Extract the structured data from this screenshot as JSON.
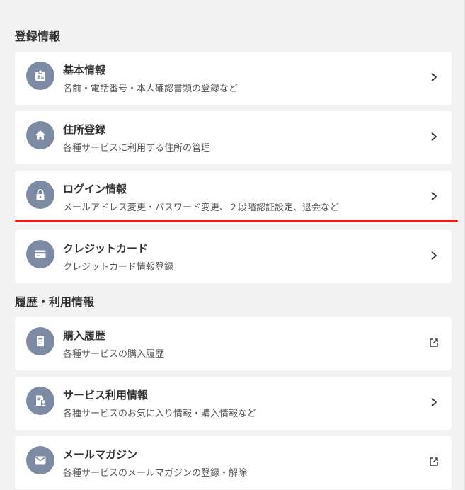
{
  "sections": [
    {
      "title": "登録情報"
    },
    {
      "title": "履歴・利用情報"
    }
  ],
  "items": [
    {
      "title": "基本情報",
      "desc": "名前・電話番号・本人確認書類の登録など",
      "icon": "id-card-icon",
      "trailing": "chevron-right-icon"
    },
    {
      "title": "住所登録",
      "desc": "各種サービスに利用する住所の管理",
      "icon": "home-icon",
      "trailing": "chevron-right-icon"
    },
    {
      "title": "ログイン情報",
      "desc": "メールアドレス変更・パスワード変更、２段階認証設定、退会など",
      "icon": "lock-icon",
      "trailing": "chevron-right-icon"
    },
    {
      "title": "クレジットカード",
      "desc": "クレジットカード情報登録",
      "icon": "credit-card-icon",
      "trailing": "chevron-right-icon"
    },
    {
      "title": "購入履歴",
      "desc": "各種サービスの購入履歴",
      "icon": "receipt-icon",
      "trailing": "external-link-icon"
    },
    {
      "title": "サービス利用情報",
      "desc": "各種サービスのお気に入り情報・購入情報など",
      "icon": "user-document-icon",
      "trailing": "chevron-right-icon"
    },
    {
      "title": "メールマガジン",
      "desc": "各種サービスのメールマガジンの登録・解除",
      "icon": "mail-icon",
      "trailing": "external-link-icon"
    }
  ],
  "colors": {
    "background": "#f2f2f2",
    "card": "#ffffff",
    "icon_circle": "#7c8aa3",
    "highlight_line": "#e22222"
  }
}
